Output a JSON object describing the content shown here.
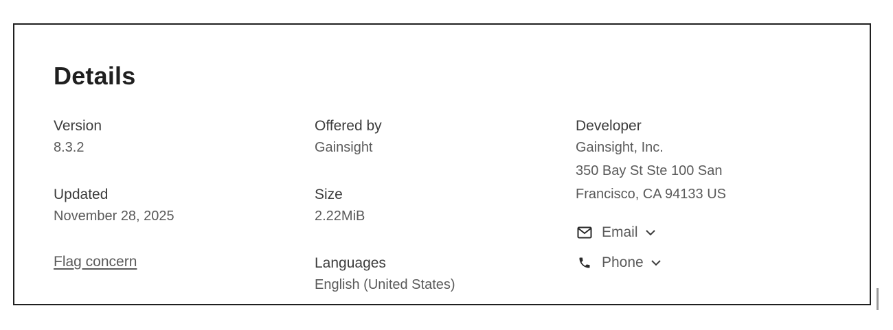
{
  "details": {
    "title": "Details",
    "version": {
      "label": "Version",
      "value": "8.3.2"
    },
    "updated": {
      "label": "Updated",
      "value": "November 28, 2025"
    },
    "flag": {
      "label": "Flag concern"
    },
    "offered_by": {
      "label": "Offered by",
      "value": "Gainsight"
    },
    "size": {
      "label": "Size",
      "value": "2.22MiB"
    },
    "languages": {
      "label": "Languages",
      "value": "English (United States)"
    },
    "developer": {
      "label": "Developer",
      "name": "Gainsight, Inc.",
      "address_line1": "350 Bay St Ste 100 San",
      "address_line2": "Francisco, CA 94133 US"
    },
    "contact": {
      "email_label": "Email",
      "email_icon": "mail-icon",
      "phone_label": "Phone",
      "phone_icon": "phone-icon",
      "chevron_icon": "chevron-down-icon"
    }
  }
}
